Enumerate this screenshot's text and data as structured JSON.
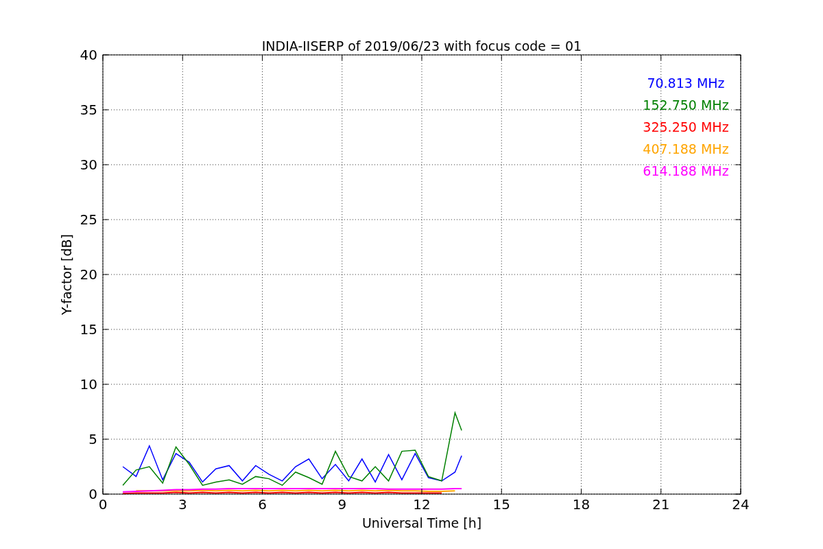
{
  "chart_data": {
    "type": "line",
    "title": "INDIA-IISERP of 2019/06/23 with focus code = 01",
    "xlabel": "Universal Time [h]",
    "ylabel": "Y-factor [dB]",
    "x": [
      0.75,
      1.25,
      1.75,
      2.25,
      2.75,
      3.25,
      3.75,
      4.25,
      4.75,
      5.25,
      5.75,
      6.25,
      6.75,
      7.25,
      7.75,
      8.25,
      8.75,
      9.25,
      9.75,
      10.25,
      10.75,
      11.25,
      11.75,
      12.25,
      12.75,
      13.25,
      13.5
    ],
    "series": [
      {
        "name": "70.813 MHz",
        "color": "#0000ff",
        "values": [
          2.5,
          1.6,
          4.4,
          1.3,
          3.7,
          2.9,
          1.1,
          2.3,
          2.6,
          1.2,
          2.6,
          1.8,
          1.2,
          2.5,
          3.2,
          1.4,
          2.7,
          1.2,
          3.2,
          1.1,
          3.6,
          1.3,
          3.7,
          1.5,
          1.2,
          2.0,
          3.5
        ]
      },
      {
        "name": "152.750 MHz",
        "color": "#008000",
        "values": [
          0.8,
          2.2,
          2.5,
          1.0,
          4.3,
          2.7,
          0.8,
          1.1,
          1.3,
          0.9,
          1.6,
          1.4,
          0.8,
          2.0,
          1.5,
          0.9,
          3.9,
          1.6,
          1.2,
          2.5,
          1.2,
          3.9,
          4.0,
          1.6,
          1.2,
          7.4,
          5.8
        ]
      },
      {
        "name": "325.250 MHz",
        "color": "#ff0000",
        "values": [
          0.05,
          0.1,
          0.1,
          0.1,
          0.15,
          0.1,
          0.15,
          0.1,
          0.15,
          0.1,
          0.15,
          0.1,
          0.15,
          0.1,
          0.15,
          0.1,
          0.15,
          0.1,
          0.15,
          0.1,
          0.15,
          0.1,
          0.1,
          0.1,
          0.1,
          null,
          null
        ]
      },
      {
        "name": "407.188 MHz",
        "color": "#ffa500",
        "values": [
          null,
          0.3,
          0.3,
          0.3,
          0.3,
          0.3,
          0.35,
          0.3,
          0.35,
          0.3,
          0.35,
          0.3,
          0.35,
          0.3,
          0.35,
          0.3,
          0.35,
          0.3,
          0.35,
          0.3,
          0.35,
          0.3,
          0.3,
          0.25,
          0.25,
          0.3,
          null
        ]
      },
      {
        "name": "614.188 MHz",
        "color": "#ff00ff",
        "values": [
          0.2,
          0.25,
          0.3,
          0.35,
          0.4,
          0.4,
          0.45,
          0.45,
          0.5,
          0.5,
          0.5,
          0.5,
          0.5,
          0.5,
          0.5,
          0.5,
          0.5,
          0.5,
          0.5,
          0.5,
          0.45,
          0.45,
          0.45,
          0.45,
          0.45,
          0.5,
          0.5
        ]
      }
    ],
    "grid": true,
    "xlim": [
      0,
      24
    ],
    "ylim": [
      0,
      40
    ],
    "xticks": [
      0,
      3,
      6,
      9,
      12,
      15,
      18,
      21,
      24
    ],
    "yticks": [
      0,
      5,
      10,
      15,
      20,
      25,
      30,
      35,
      40
    ]
  }
}
